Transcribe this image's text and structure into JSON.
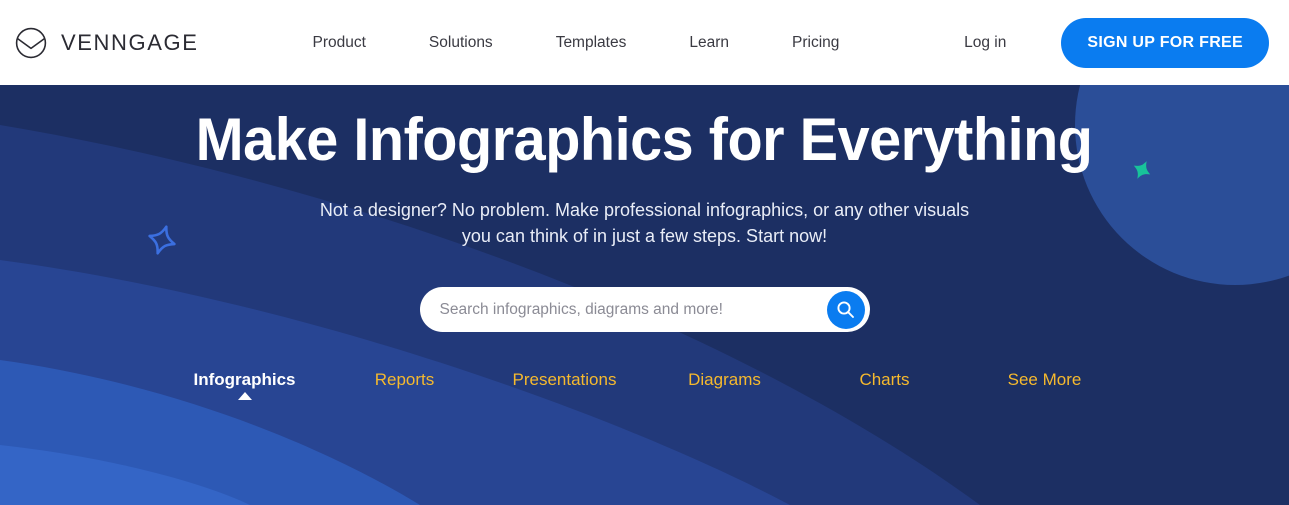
{
  "header": {
    "logo_icon": "venngage-circle-v-logo",
    "brand_name": "VENNGAGE",
    "nav": [
      {
        "label": "Product"
      },
      {
        "label": "Solutions"
      },
      {
        "label": "Templates"
      },
      {
        "label": "Learn"
      },
      {
        "label": "Pricing"
      }
    ],
    "login_label": "Log in",
    "signup_label": "SIGN UP FOR FREE",
    "signup_color": "#0a7cf0"
  },
  "hero": {
    "headline": "Make Infographics for Everything",
    "subhead_line1": "Not a designer? No problem. Make professional infographics, or any other visuals",
    "subhead_line2": "you can think of in just a few steps. Start now!",
    "background_color": "#1C2F63",
    "shape_color_mid": "#25407F",
    "shape_color_light": "#2B4E98",
    "shape_color_bright": "#2D59B5",
    "sparkle_blue": "#3B6FE0",
    "sparkle_teal": "#18C39A"
  },
  "search": {
    "placeholder": "Search infographics, diagrams and more!",
    "value": "",
    "button_icon": "search-icon",
    "button_color": "#0a7cf0"
  },
  "categories": {
    "accent_color": "#F5B92E",
    "active_color": "#ffffff",
    "items": [
      {
        "label": "Infographics",
        "active": true
      },
      {
        "label": "Reports",
        "active": false
      },
      {
        "label": "Presentations",
        "active": false
      },
      {
        "label": "Diagrams",
        "active": false
      },
      {
        "label": "Charts",
        "active": false
      },
      {
        "label": "See More",
        "active": false
      }
    ]
  }
}
